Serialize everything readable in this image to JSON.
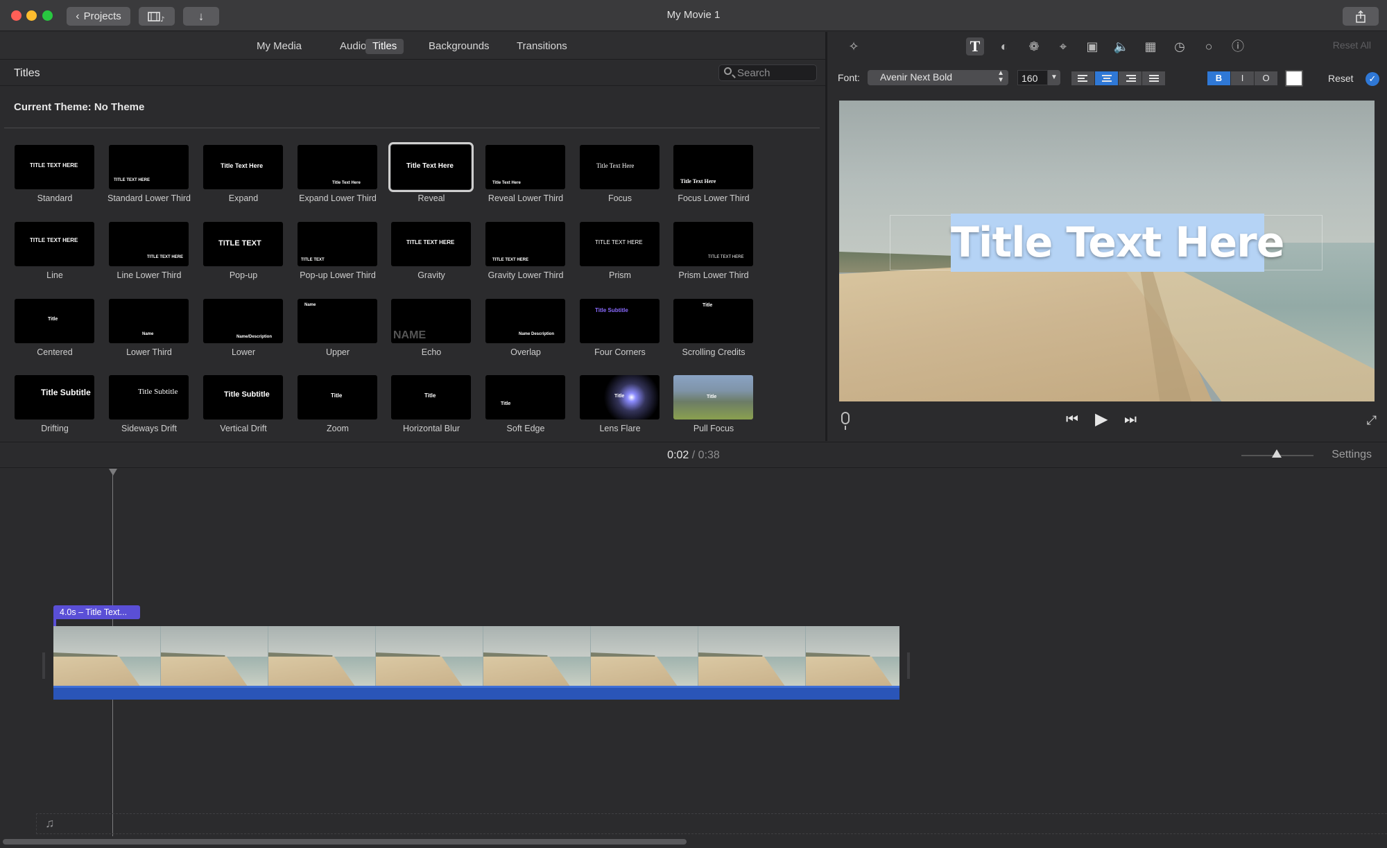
{
  "window": {
    "title": "My Movie 1",
    "projects_label": "Projects"
  },
  "browser": {
    "tabs": [
      {
        "label": "My Media"
      },
      {
        "label": "Audio"
      },
      {
        "label": "Titles",
        "selected": true
      },
      {
        "label": "Backgrounds"
      },
      {
        "label": "Transitions"
      }
    ],
    "title": "Titles",
    "search_placeholder": "Search",
    "theme_label": "Current Theme: No Theme",
    "titles": [
      {
        "label": "Standard",
        "thumb": "TITLE TEXT HERE"
      },
      {
        "label": "Standard Lower Third",
        "thumb": "TITLE TEXT HERE"
      },
      {
        "label": "Expand",
        "thumb": "Title Text Here"
      },
      {
        "label": "Expand Lower Third",
        "thumb": "Title Text Here"
      },
      {
        "label": "Reveal",
        "thumb": "Title Text Here",
        "selected": true
      },
      {
        "label": "Reveal Lower Third",
        "thumb": "Title Text Here"
      },
      {
        "label": "Focus",
        "thumb": "Title Text Here"
      },
      {
        "label": "Focus Lower Third",
        "thumb": "Title Text Here"
      },
      {
        "label": "Line",
        "thumb": "TITLE TEXT HERE"
      },
      {
        "label": "Line Lower Third",
        "thumb": "TITLE TEXT HERE"
      },
      {
        "label": "Pop-up",
        "thumb": "TITLE TEXT"
      },
      {
        "label": "Pop-up Lower Third",
        "thumb": "TITLE TEXT"
      },
      {
        "label": "Gravity",
        "thumb": "TITLE TEXT HERE"
      },
      {
        "label": "Gravity Lower Third",
        "thumb": "TITLE TEXT HERE"
      },
      {
        "label": "Prism",
        "thumb": "TITLE TEXT HERE"
      },
      {
        "label": "Prism Lower Third",
        "thumb": "TITLE TEXT HERE"
      },
      {
        "label": "Centered",
        "thumb": "Title"
      },
      {
        "label": "Lower Third",
        "thumb": "Name"
      },
      {
        "label": "Lower",
        "thumb": "Name/Description"
      },
      {
        "label": "Upper",
        "thumb": "Name"
      },
      {
        "label": "Echo",
        "thumb": "NAME"
      },
      {
        "label": "Overlap",
        "thumb": "Name Description"
      },
      {
        "label": "Four Corners",
        "thumb": "Title Subtitle"
      },
      {
        "label": "Scrolling Credits",
        "thumb": "Title"
      },
      {
        "label": "Drifting",
        "thumb": "Title Subtitle"
      },
      {
        "label": "Sideways Drift",
        "thumb": "Title Subtitle"
      },
      {
        "label": "Vertical Drift",
        "thumb": "Title Subtitle"
      },
      {
        "label": "Zoom",
        "thumb": "Title"
      },
      {
        "label": "Horizontal Blur",
        "thumb": "Title"
      },
      {
        "label": "Soft Edge",
        "thumb": "Title"
      },
      {
        "label": "Lens Flare",
        "thumb": "Title"
      },
      {
        "label": "Pull Focus",
        "thumb": "Title"
      }
    ]
  },
  "inspector": {
    "reset_all_label": "Reset All",
    "font_label": "Font:",
    "font_value": "Avenir Next Bold",
    "size_value": "160",
    "bold_label": "B",
    "italic_label": "I",
    "outline_label": "O",
    "text_color": "#ffffff",
    "reset_label": "Reset"
  },
  "viewer": {
    "title_text": "Title Text Here",
    "selection_color": "#b5d3f5"
  },
  "timeline": {
    "current_time": "0:02",
    "separator": "/",
    "total_time": "0:38",
    "settings_label": "Settings",
    "title_clip_label": "4.0s – Title Text...",
    "title_clip_color": "#5a4fd6",
    "audio_color": "#2a55b8"
  },
  "icons": [
    "magic-wand-icon",
    "text-icon",
    "color-balance-icon",
    "color-palette-icon",
    "crop-icon",
    "stabilization-camera-icon",
    "volume-icon",
    "equalizer-icon",
    "speed-icon",
    "filter-icon",
    "info-icon",
    "microphone-icon",
    "music-note-icon",
    "share-icon",
    "import-arrow-icon"
  ]
}
